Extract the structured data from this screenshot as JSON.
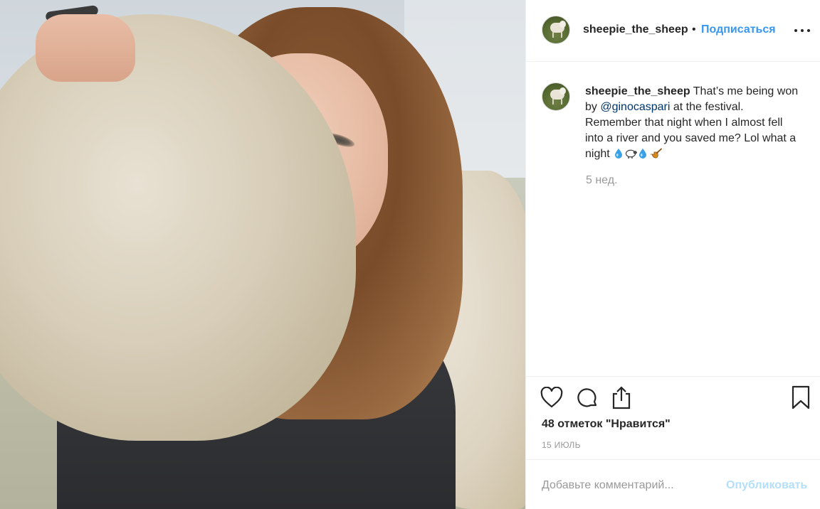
{
  "post": {
    "username": "sheepie_the_sheep",
    "separator": "•",
    "follow_label": "Подписаться",
    "caption": {
      "username": "sheepie_the_sheep",
      "text_before": " That’s me being won by ",
      "mention": "@ginocaspari",
      "text_after": " at the festival. Remember that night when I almost fell into a river and you saved me? Lol what a night ",
      "emoji_icons": [
        "droplet-icon",
        "sheep-icon",
        "droplet-icon",
        "pipe-icon"
      ]
    },
    "caption_time": "5 нед.",
    "likes": "48 отметок \"Нравится\"",
    "date": "15 ИЮЛЬ"
  },
  "comment_form": {
    "placeholder": "Добавьте комментарий...",
    "publish_label": "Опубликовать"
  },
  "colors": {
    "accent": "#3897f0",
    "publish_disabled": "#b2dffc",
    "mention": "#003569",
    "muted": "#999999",
    "text": "#262626"
  }
}
